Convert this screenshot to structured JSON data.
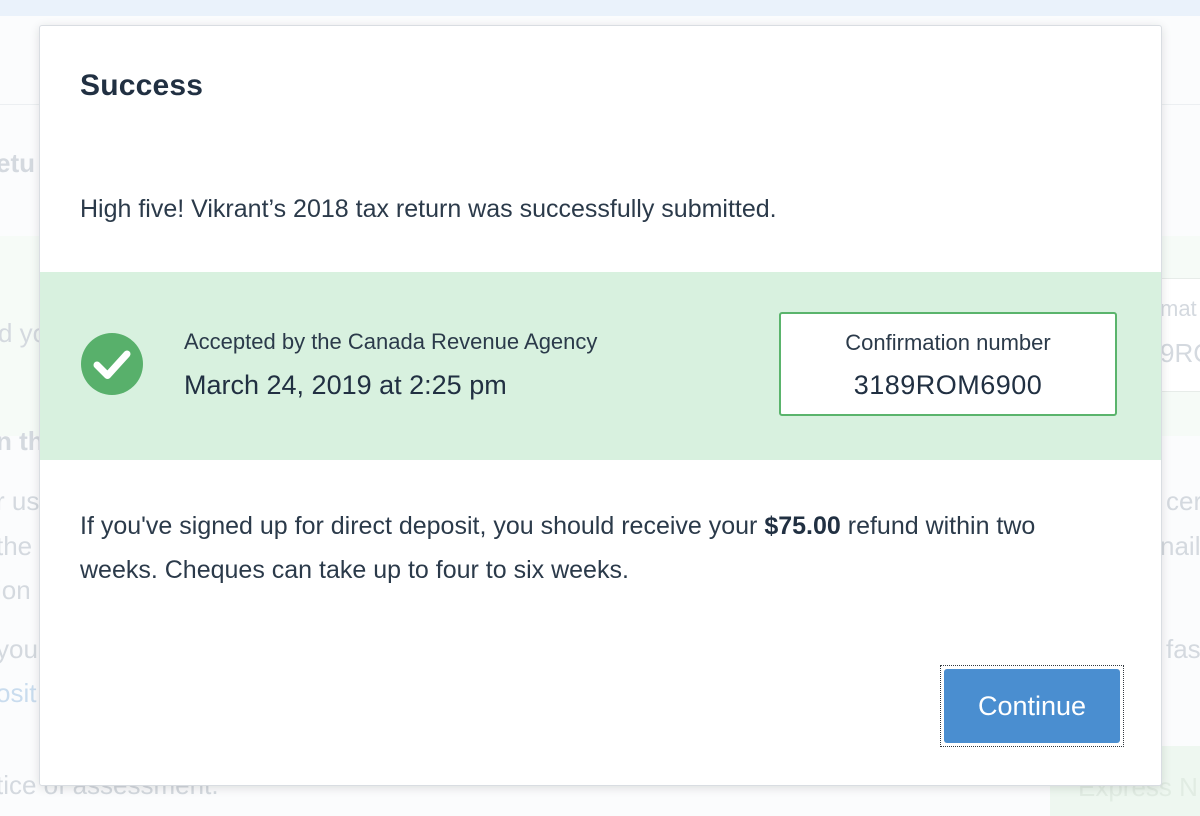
{
  "background": {
    "fragments": [
      "etu",
      "d yo",
      "n th",
      "r us",
      "the",
      "ion",
      "you",
      "osit",
      "tice of assessment.",
      "mat",
      "9RC",
      "cer",
      "nail.",
      "fas",
      "Express N"
    ]
  },
  "modal": {
    "title": "Success",
    "message": "High five! Vikrant’s 2018 tax return was successfully submitted.",
    "accepted": {
      "label": "Accepted by the Canada Revenue Agency",
      "date": "March 24, 2019 at 2:25 pm"
    },
    "confirmation": {
      "label": "Confirmation number",
      "number": "3189ROM6900"
    },
    "refund": {
      "before": "If you've signed up for direct deposit, you should receive your ",
      "amount": "$75.00",
      "after": " refund within two weeks. Cheques can take up to four to six weeks."
    },
    "continue_label": "Continue"
  },
  "icons": {
    "success": "check-circle-icon"
  },
  "colors": {
    "accent_blue": "#4a8ed0",
    "success_green": "#58b06b",
    "band_green": "#d8f1df",
    "confirm_border": "#5ab46c"
  }
}
